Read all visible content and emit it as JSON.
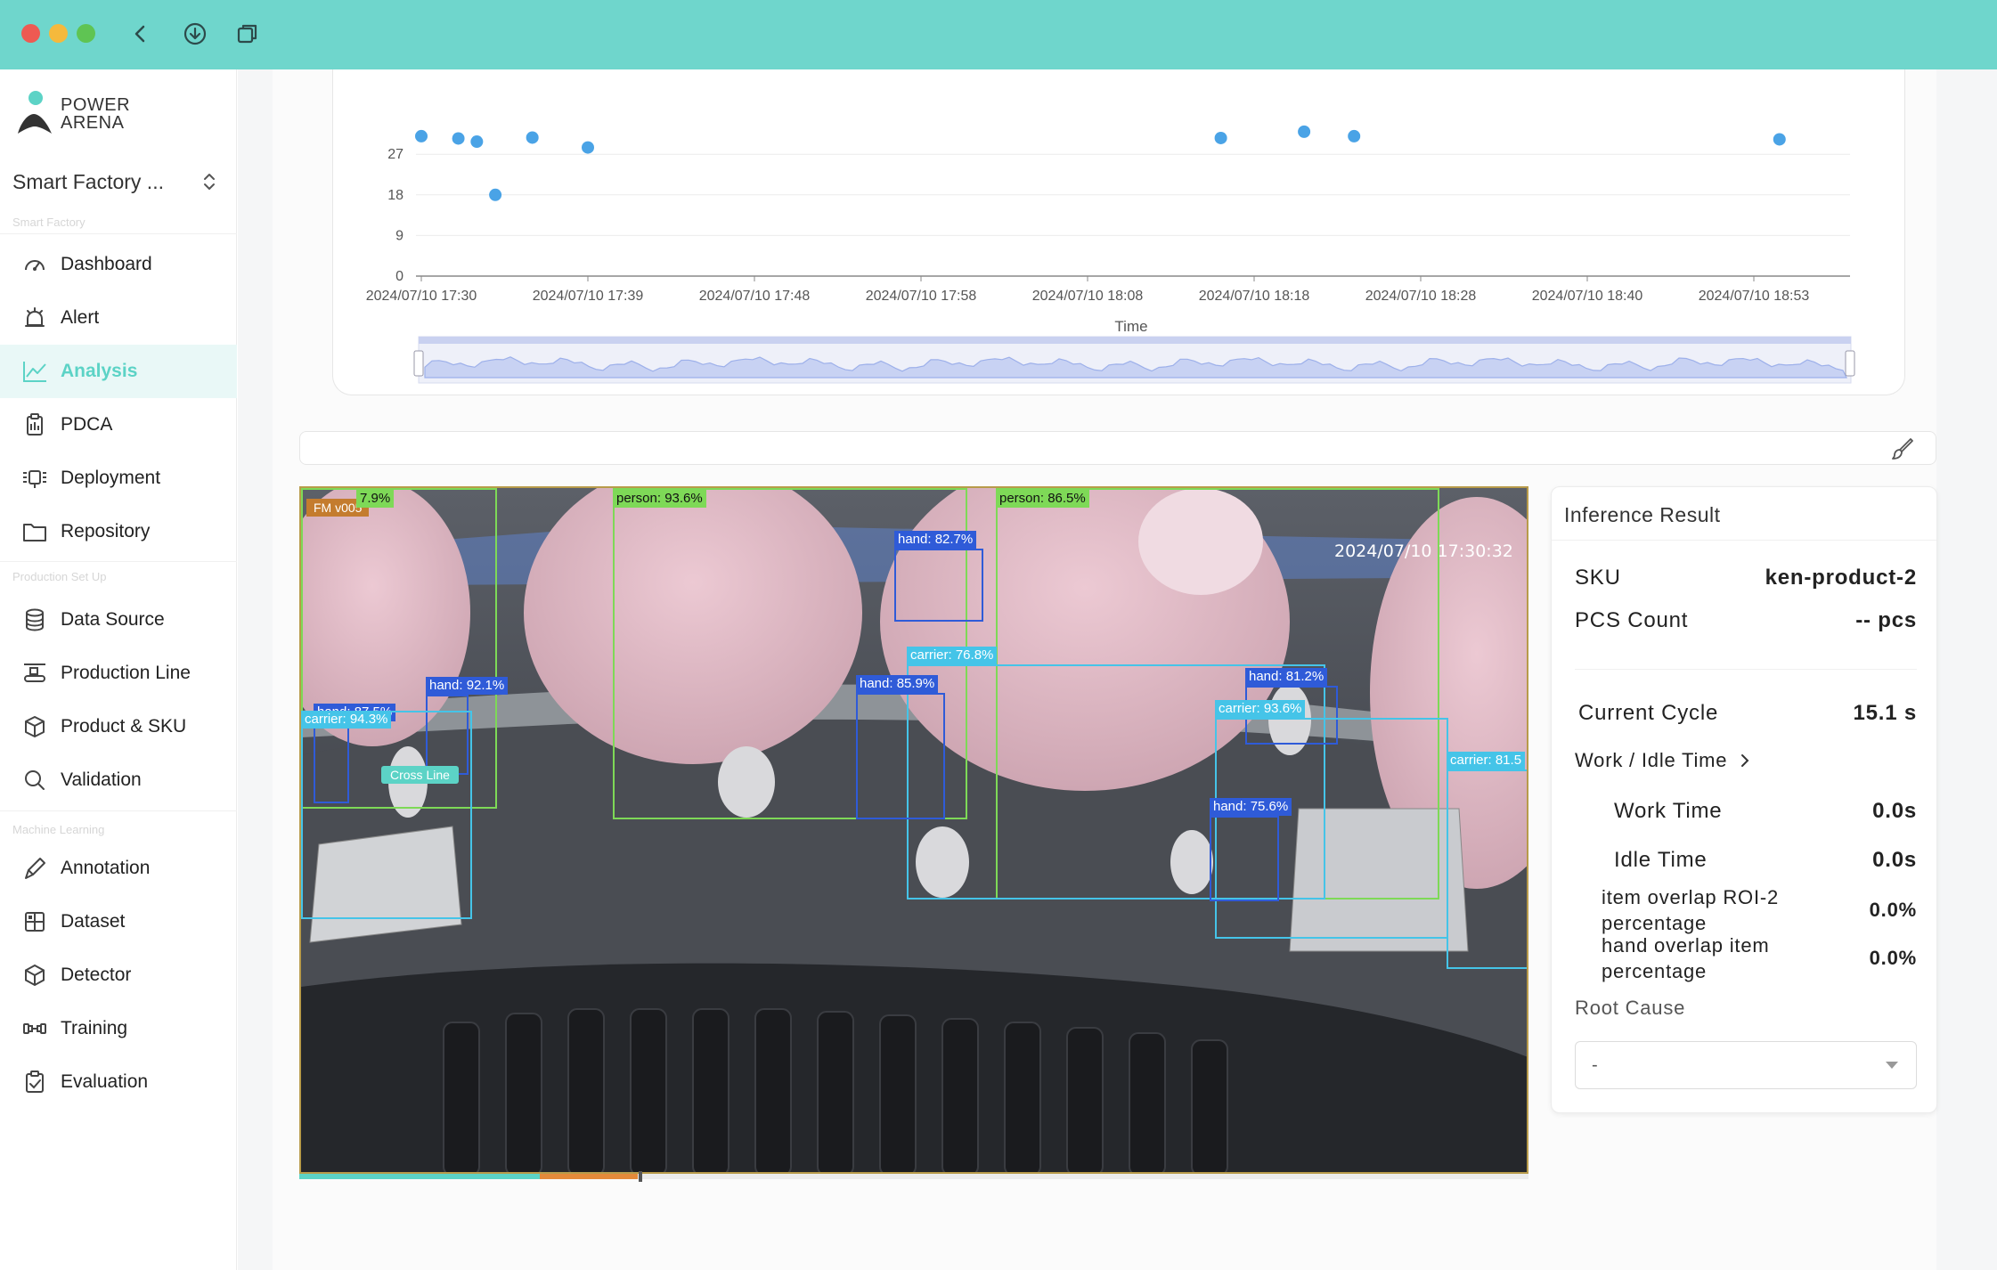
{
  "app": {
    "logo_text_line1": "POWER",
    "logo_text_line2": "ARENA"
  },
  "workspace": {
    "name": "Smart Factory ..."
  },
  "sidebar": {
    "section_smart_factory": "Smart Factory",
    "section_production": "Production Set Up",
    "section_ml": "Machine Learning",
    "items": [
      {
        "label": "Dashboard",
        "icon": "gauge-icon"
      },
      {
        "label": "Alert",
        "icon": "alarm-icon"
      },
      {
        "label": "Analysis",
        "icon": "chart-line-icon",
        "active": true
      },
      {
        "label": "PDCA",
        "icon": "clipboard-icon"
      },
      {
        "label": "Deployment",
        "icon": "deployment-icon"
      },
      {
        "label": "Repository",
        "icon": "folder-icon"
      },
      {
        "label": "Data Source",
        "icon": "database-icon"
      },
      {
        "label": "Production Line",
        "icon": "conveyor-icon"
      },
      {
        "label": "Product & SKU",
        "icon": "cube-icon"
      },
      {
        "label": "Validation",
        "icon": "search-icon"
      },
      {
        "label": "Annotation",
        "icon": "pen-icon"
      },
      {
        "label": "Dataset",
        "icon": "grid-icon"
      },
      {
        "label": "Detector",
        "icon": "hexagon-icon"
      },
      {
        "label": "Training",
        "icon": "dumbbell-icon"
      },
      {
        "label": "Evaluation",
        "icon": "clipboard-check-icon"
      }
    ]
  },
  "chart_data": {
    "type": "scatter",
    "xlabel": "Time",
    "ylabel": "",
    "y_ticks": [
      0,
      9,
      18,
      27
    ],
    "x_ticks": [
      "2024/07/10 17:30",
      "2024/07/10 17:39",
      "2024/07/10 17:48",
      "2024/07/10 17:58",
      "2024/07/10 18:08",
      "2024/07/10 18:18",
      "2024/07/10 18:28",
      "2024/07/10 18:40",
      "2024/07/10 18:53"
    ],
    "point_color": "#4aa3e6",
    "points": [
      {
        "x": "2024/07/10 17:30",
        "y": 31
      },
      {
        "x": "2024/07/10 17:32",
        "y": 30.5
      },
      {
        "x": "2024/07/10 17:33",
        "y": 29.8
      },
      {
        "x": "2024/07/10 17:34",
        "y": 18
      },
      {
        "x": "2024/07/10 17:36",
        "y": 30.7
      },
      {
        "x": "2024/07/10 17:39",
        "y": 28.5
      },
      {
        "x": "2024/07/10 18:16",
        "y": 30.6
      },
      {
        "x": "2024/07/10 18:21",
        "y": 32
      },
      {
        "x": "2024/07/10 18:24",
        "y": 31
      },
      {
        "x": "2024/07/10 18:55",
        "y": 30.3
      }
    ]
  },
  "video": {
    "timestamp": "2024/07/10 17:30:32",
    "camera_badge": "FM v005",
    "crossline_label": "Cross Line",
    "detections": [
      {
        "label": "person: 93.6%"
      },
      {
        "label": "person: 86.5%"
      },
      {
        "label": "hand: 82.7%"
      },
      {
        "label": "carrier: 76.8%"
      },
      {
        "label": "hand: 85.9%"
      },
      {
        "label": "hand: 92.1%"
      },
      {
        "label": "hand: 87.5%"
      },
      {
        "label": "hand: 81.2%"
      },
      {
        "label": "carrier: 93.6%"
      },
      {
        "label": "hand: 75.6%"
      },
      {
        "label": "carrier: 81.5"
      },
      {
        "label": "carrier: 94.3%"
      },
      {
        "label": "7.9%"
      }
    ]
  },
  "inference": {
    "title": "Inference Result",
    "sku_label": "SKU",
    "sku_value": "ken-product-2",
    "pcs_label": "PCS Count",
    "pcs_value": "-- pcs",
    "cycle_label": "Current Cycle",
    "cycle_value": "15.1 s",
    "work_idle_label": "Work / Idle Time",
    "work_label": "Work Time",
    "work_value": "0.0s",
    "idle_label": "Idle Time",
    "idle_value": "0.0s",
    "overlap1_label_a": "item overlap ROI-2",
    "overlap1_label_b": "percentage",
    "overlap1_value": "0.0%",
    "overlap2_label_a": "hand overlap item",
    "overlap2_label_b": "percentage",
    "overlap2_value": "0.0%",
    "root_cause_label": "Root Cause",
    "root_cause_value": "-"
  }
}
